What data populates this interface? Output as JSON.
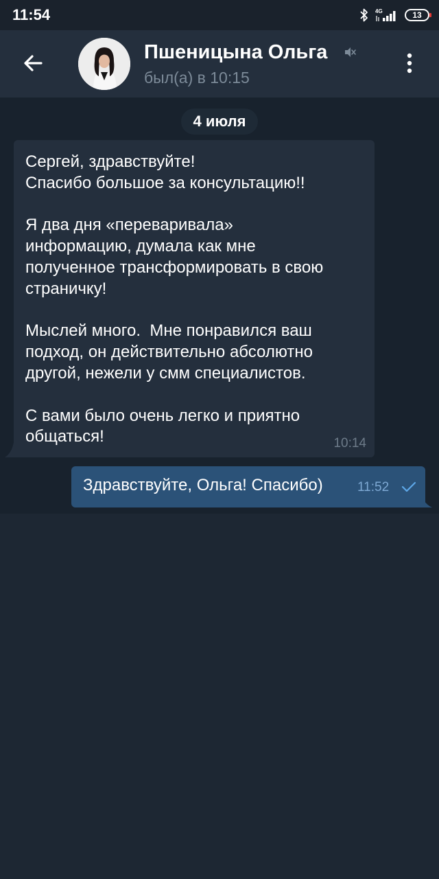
{
  "status_bar": {
    "time": "11:54",
    "network": "4G",
    "battery": "13",
    "icons": [
      "bluetooth-icon",
      "signal-icon",
      "battery-icon"
    ]
  },
  "header": {
    "contact_name": "Пшеницына Ольга",
    "last_seen": "был(а) в 10:15",
    "icons": [
      "back-arrow-icon",
      "mute-icon",
      "more-vert-icon"
    ]
  },
  "chat": {
    "date_label": "4 июля",
    "messages": [
      {
        "direction": "incoming",
        "text": "Сергей, здравствуйте!\nСпасибо большое за консультацию!!\n\nЯ два дня «переваривала»\nинформацию, думала как мне\nполученное трансформировать в свою\nстраничку!\n\nМыслей много.  Мне понравился ваш\nподход, он действительно абсолютно\nдругой, нежели у смм специалистов.\n\nС вами было очень легко и приятно\nобщаться!",
        "time": "10:14"
      },
      {
        "direction": "outgoing",
        "text": "Здравствуйте, Ольга! Спасибо)",
        "time": "11:52",
        "status": "sent"
      }
    ]
  },
  "colors": {
    "header_bg": "#242f3d",
    "chat_bg": "#18222d",
    "incoming_bubble": "#242f3d",
    "outgoing_bubble": "#2b5278",
    "secondary_text": "#7d8b99",
    "accent": "#5ea8e8"
  }
}
